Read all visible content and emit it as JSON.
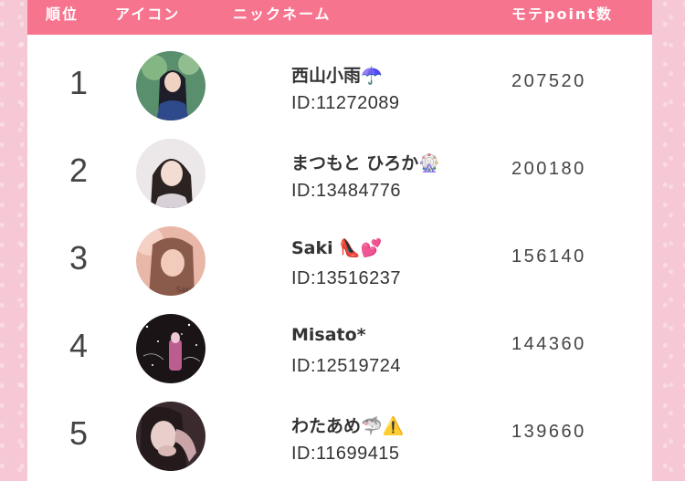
{
  "header": {
    "rank": "順位",
    "icon": "アイコン",
    "nickname": "ニックネーム",
    "points": "モテpoint数"
  },
  "rows": [
    {
      "rank": "1",
      "nickname": "西山小雨☂️",
      "id": "ID:11272089",
      "points": "207520",
      "avatar_color": "#5a8f6e",
      "avatar_accent": "#2f4a8a"
    },
    {
      "rank": "2",
      "nickname": "まつもと ひろか🎡",
      "id": "ID:13484776",
      "points": "200180",
      "avatar_color": "#d9d4d8",
      "avatar_accent": "#3b2e2e"
    },
    {
      "rank": "3",
      "nickname": "Saki 👠💕",
      "id": "ID:13516237",
      "points": "156140",
      "avatar_color": "#e9b7a8",
      "avatar_accent": "#8a5a4a"
    },
    {
      "rank": "4",
      "nickname": "Misato*",
      "id": "ID:12519724",
      "points": "144360",
      "avatar_color": "#1a1416",
      "avatar_accent": "#d96aa6"
    },
    {
      "rank": "5",
      "nickname": "わたあめ🦈⚠️",
      "id": "ID:11699415",
      "points": "139660",
      "avatar_color": "#3a2a2e",
      "avatar_accent": "#c9a5a8"
    }
  ]
}
